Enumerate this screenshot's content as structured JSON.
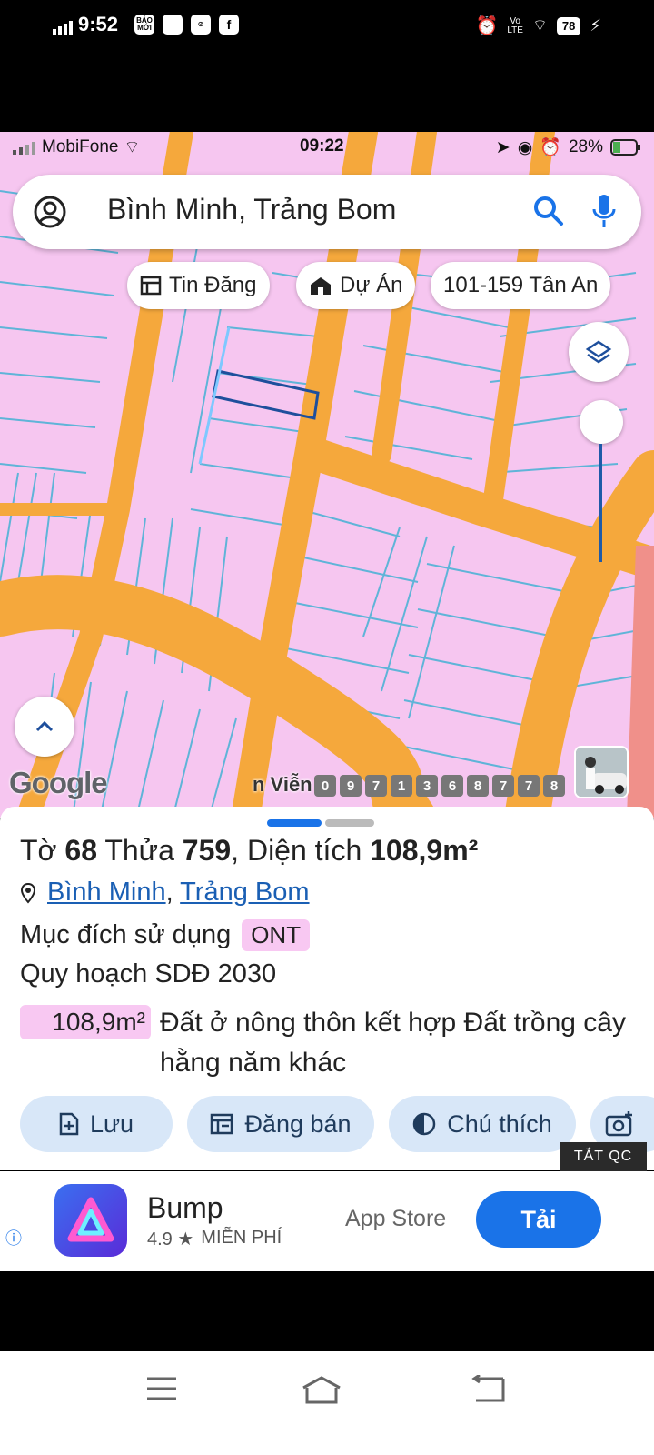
{
  "outer_status": {
    "time": "9:52",
    "app_icons": [
      "BÁO MỚI",
      "app",
      "link",
      "f"
    ],
    "battery": "78"
  },
  "inner_status": {
    "carrier": "MobiFone",
    "time": "09:22",
    "battery": "28%"
  },
  "search": {
    "query": "Bình Minh, Trảng Bom"
  },
  "chips": [
    {
      "label": "Tin Đăng",
      "icon": "listing-icon"
    },
    {
      "label": "Dự Án",
      "icon": "project-house-icon"
    },
    {
      "label": "101-159 Tân An",
      "icon": ""
    }
  ],
  "map": {
    "google_label": "Google",
    "street_label": "n Viễn",
    "phone_digits": [
      "0",
      "9",
      "7",
      "1",
      "3",
      "6",
      "8",
      "7",
      "7",
      "8"
    ]
  },
  "parcel": {
    "sheet_label": "Tờ",
    "sheet_no": "68",
    "lot_label": "Thửa",
    "lot_no": "759",
    "area_label": ", Diện tích",
    "area": "108,9m²",
    "ward": "Bình Minh",
    "district": "Trảng Bom",
    "purpose_label": "Mục đích sử dụng",
    "purpose_code": "ONT",
    "plan_label": "Quy hoạch SDĐ 2030",
    "plan_area": "108,9m²",
    "plan_use": "Đất ở nông thôn kết hợp Đất trồng cây hằng năm khác"
  },
  "actions": [
    {
      "label": "Lưu",
      "icon": "save-doc-icon"
    },
    {
      "label": "Đăng bán",
      "icon": "post-sale-icon"
    },
    {
      "label": "Chú thích",
      "icon": "legend-contrast-icon"
    },
    {
      "label": "",
      "icon": "add-photo-icon"
    }
  ],
  "ad": {
    "close_label": "TẮT QC",
    "app_name": "Bump",
    "rating": "4.9 ★",
    "price": "MIỄN PHÍ",
    "store": "App Store",
    "install_label": "Tải"
  },
  "colors": {
    "map_land": "#f6c6f0",
    "map_road": "#f5a83c",
    "parcel_line": "#5fb4d8",
    "accent": "#1a73e8"
  }
}
